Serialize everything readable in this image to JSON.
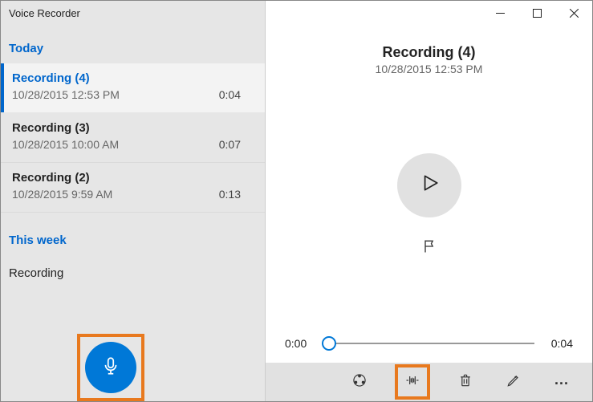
{
  "appTitle": "Voice Recorder",
  "sections": {
    "today": "Today",
    "thisWeek": "This week"
  },
  "recordings": {
    "today": [
      {
        "name": "Recording (4)",
        "date": "10/28/2015 12:53 PM",
        "duration": "0:04",
        "selected": true
      },
      {
        "name": "Recording (3)",
        "date": "10/28/2015 10:00 AM",
        "duration": "0:07",
        "selected": false
      },
      {
        "name": "Recording (2)",
        "date": "10/28/2015 9:59 AM",
        "duration": "0:13",
        "selected": false
      }
    ],
    "thisWeekPartial": "Recording"
  },
  "detail": {
    "title": "Recording (4)",
    "date": "10/28/2015 12:53 PM",
    "currentTime": "0:00",
    "totalTime": "0:04"
  },
  "windowControls": {
    "minimize": "minimize",
    "maximize": "maximize",
    "close": "close"
  },
  "toolbar": {
    "share": "share",
    "trim": "trim",
    "delete": "delete",
    "rename": "rename",
    "more": "..."
  },
  "colors": {
    "accent": "#0078d7",
    "highlight": "#e8791e"
  }
}
